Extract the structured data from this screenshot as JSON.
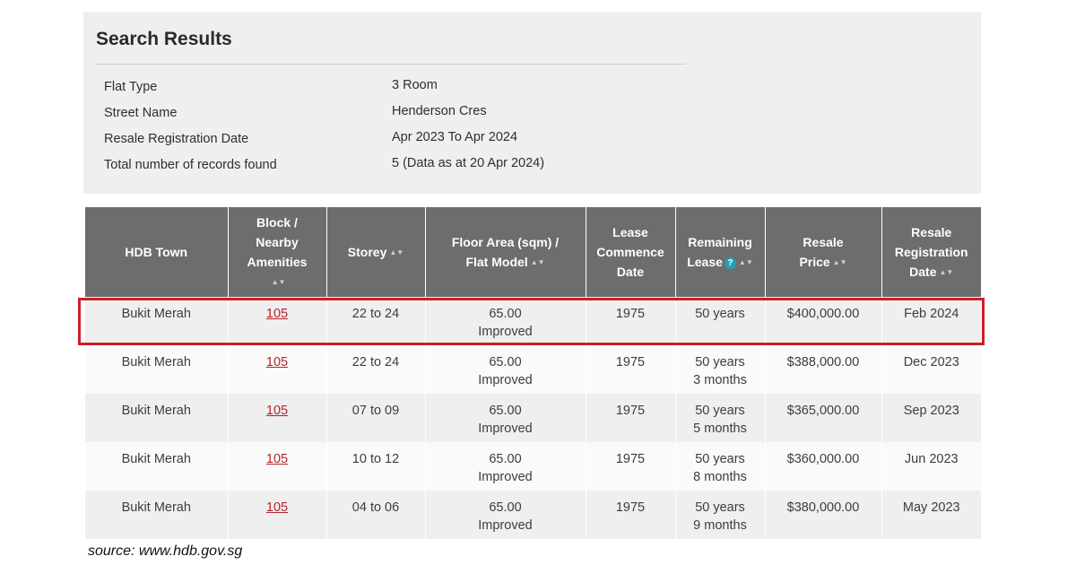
{
  "summary": {
    "title": "Search Results",
    "rows": [
      {
        "label": "Flat Type",
        "value": "3 Room"
      },
      {
        "label": "Street Name",
        "value": "Henderson Cres"
      },
      {
        "label": "Resale Registration Date",
        "value": "Apr 2023 To Apr 2024"
      },
      {
        "label": "Total number of records found",
        "value": "5 (Data as at 20 Apr 2024)"
      }
    ]
  },
  "table": {
    "headers": {
      "town": "HDB Town",
      "block_line1": "Block /",
      "block_line2": "Nearby",
      "block_line3": "Amenities",
      "storey": "Storey",
      "area_line1": "Floor Area (sqm) /",
      "area_line2": "Flat Model",
      "lease_line1": "Lease",
      "lease_line2": "Commence",
      "lease_line3": "Date",
      "remaining_line1": "Remaining",
      "remaining_line2": "Lease",
      "price_line1": "Resale",
      "price_line2": "Price",
      "regdate_line1": "Resale",
      "regdate_line2": "Registration",
      "regdate_line3": "Date"
    },
    "help_glyph": "?",
    "sort_glyph": "▲▼",
    "rows": [
      {
        "town": "Bukit Merah",
        "block": "105",
        "storey": "22 to 24",
        "area": "65.00",
        "model": "Improved",
        "lease_commence": "1975",
        "remaining_1": "50 years",
        "remaining_2": "",
        "price": "$400,000.00",
        "reg_date": "Feb 2024"
      },
      {
        "town": "Bukit Merah",
        "block": "105",
        "storey": "22 to 24",
        "area": "65.00",
        "model": "Improved",
        "lease_commence": "1975",
        "remaining_1": "50 years",
        "remaining_2": "3 months",
        "price": "$388,000.00",
        "reg_date": "Dec 2023"
      },
      {
        "town": "Bukit Merah",
        "block": "105",
        "storey": "07 to 09",
        "area": "65.00",
        "model": "Improved",
        "lease_commence": "1975",
        "remaining_1": "50 years",
        "remaining_2": "5 months",
        "price": "$365,000.00",
        "reg_date": "Sep 2023"
      },
      {
        "town": "Bukit Merah",
        "block": "105",
        "storey": "10 to 12",
        "area": "65.00",
        "model": "Improved",
        "lease_commence": "1975",
        "remaining_1": "50 years",
        "remaining_2": "8 months",
        "price": "$360,000.00",
        "reg_date": "Jun 2023"
      },
      {
        "town": "Bukit Merah",
        "block": "105",
        "storey": "04 to 06",
        "area": "65.00",
        "model": "Improved",
        "lease_commence": "1975",
        "remaining_1": "50 years",
        "remaining_2": "9 months",
        "price": "$380,000.00",
        "reg_date": "May 2023"
      }
    ]
  },
  "colors": {
    "header_bg": "#6d6d6d",
    "highlight_border": "#cc1f2b",
    "link": "#b5232b",
    "help_icon": "#23a0b8"
  },
  "source": "source: www.hdb.gov.sg"
}
